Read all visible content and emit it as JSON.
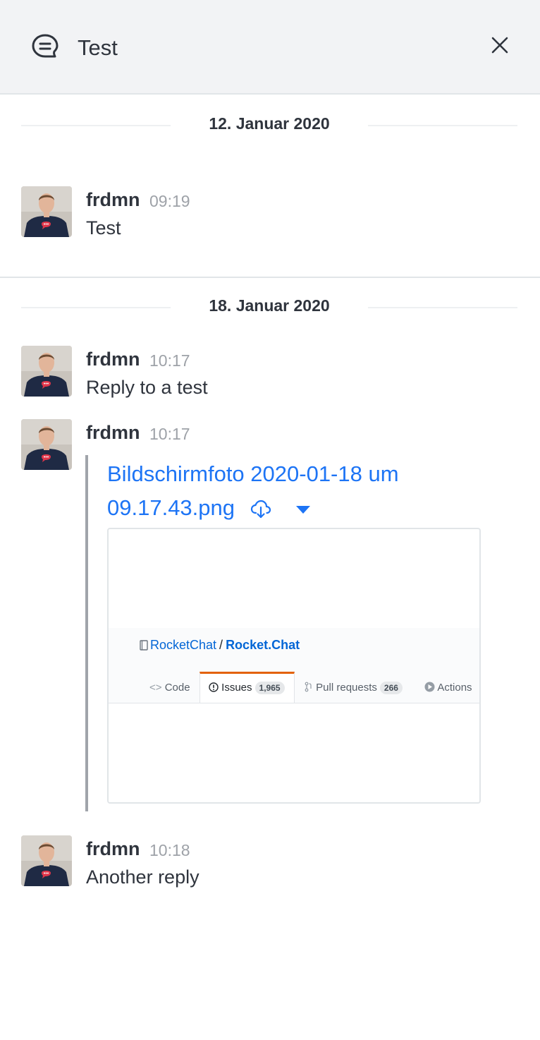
{
  "header": {
    "title": "Test",
    "thread_icon": "thread-icon",
    "close_icon": "close-icon"
  },
  "dates": [
    "12. Januar 2020",
    "18. Januar 2020"
  ],
  "messages": [
    {
      "user": "frdmn",
      "time": "09:19",
      "text": "Test"
    },
    {
      "user": "frdmn",
      "time": "10:17",
      "text": "Reply to a test"
    },
    {
      "user": "frdmn",
      "time": "10:17",
      "text": ""
    },
    {
      "user": "frdmn",
      "time": "10:18",
      "text": "Another reply"
    }
  ],
  "attachment": {
    "title": "Bildschirmfoto 2020-01-18 um 09.17.43.png",
    "download_icon": "cloud-download-icon",
    "collapse_icon": "caret-down-icon",
    "preview": {
      "repo_owner": "RocketChat",
      "separator": "/",
      "repo_name": "Rocket.Chat",
      "tabs": [
        {
          "label": "Code",
          "count": ""
        },
        {
          "label": "Issues",
          "count": "1,965"
        },
        {
          "label": "Pull requests",
          "count": "266"
        },
        {
          "label": "Actions",
          "count": ""
        }
      ],
      "accent": "#e36209"
    }
  },
  "colors": {
    "link": "#1d74f5",
    "muted": "#9ea2a8",
    "text": "#2f343d",
    "header_bg": "#f2f3f5"
  }
}
